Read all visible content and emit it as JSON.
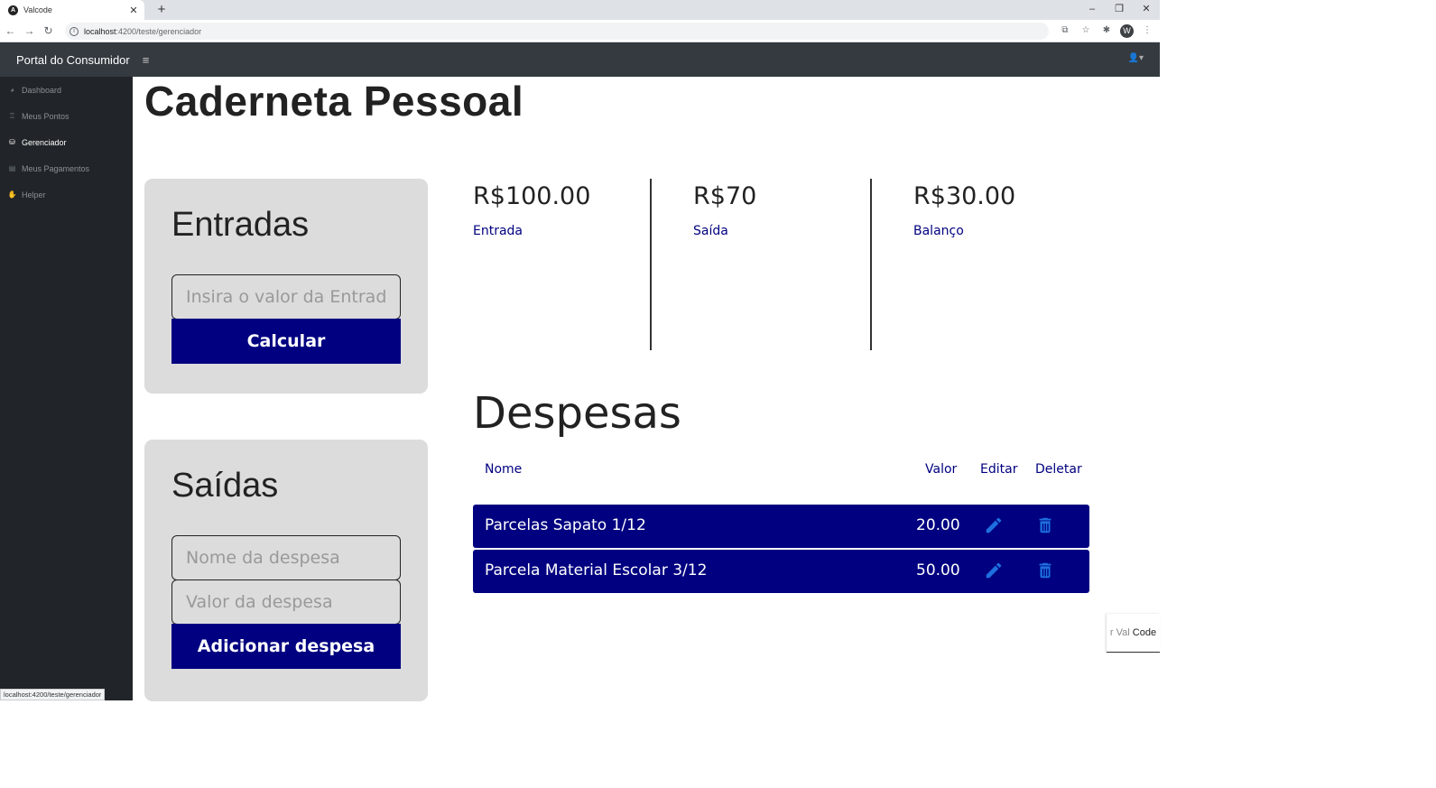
{
  "browser": {
    "tab_title": "Valcode",
    "tab_close": "✕",
    "new_tab": "+",
    "url_host": "localhost",
    "url_path": ":4200/teste/gerenciador",
    "status_url": "localhost:4200/teste/gerenciador",
    "profile_initial": "W"
  },
  "navbar": {
    "brand": "Portal do Consumidor",
    "menu_glyph": "≡",
    "user_glyph": "👤▾"
  },
  "sidebar": {
    "items": [
      {
        "label": "Dashboard",
        "icon": "dashboard-icon",
        "active": false
      },
      {
        "label": "Meus Pontos",
        "icon": "medal-icon",
        "active": false
      },
      {
        "label": "Gerenciador",
        "icon": "money-icon",
        "active": true
      },
      {
        "label": "Meus Pagamentos",
        "icon": "card-icon",
        "active": false
      },
      {
        "label": "Helper",
        "icon": "handshake-icon",
        "active": false
      }
    ]
  },
  "page": {
    "title": "Caderneta Pessoal"
  },
  "entradas": {
    "title": "Entradas",
    "input_placeholder": "Insira o valor da Entrad",
    "button_label": "Calcular"
  },
  "saidas": {
    "title": "Saídas",
    "name_placeholder": "Nome da despesa",
    "value_placeholder": "Valor da despesa",
    "button_label": "Adicionar despesa"
  },
  "summary": {
    "entrada_value": "R$100.00",
    "entrada_label": "Entrada",
    "saida_value": "R$70",
    "saida_label": "Saída",
    "balanco_value": "R$30.00",
    "balanco_label": "Balanço"
  },
  "despesas": {
    "title": "Despesas",
    "columns": {
      "nome": "Nome",
      "valor": "Valor",
      "editar": "Editar",
      "deletar": "Deletar"
    },
    "rows": [
      {
        "nome": "Parcelas Sapato 1/12",
        "valor": "20.00"
      },
      {
        "nome": "Parcela Material Escolar 3/12",
        "valor": "50.00"
      }
    ]
  },
  "floating_tab": {
    "faded_text": "r Val",
    "text": "Code"
  },
  "colors": {
    "primary": "#000080",
    "sidebar_bg": "#212529",
    "navbar_bg": "#343a40",
    "card_bg": "#dcdcdc",
    "icon_blue": "#1e6fe0"
  }
}
